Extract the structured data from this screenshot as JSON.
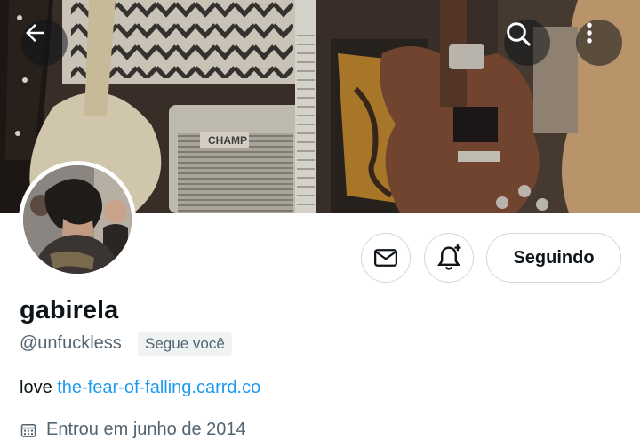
{
  "profile": {
    "display_name": "gabirela",
    "handle": "@unfuckless",
    "follows_you_badge": "Segue você",
    "bio_text": "love ",
    "bio_link": "the-fear-of-falling.carrd.co",
    "joined": "Entrou em junho de 2014"
  },
  "actions": {
    "follow_label": "Seguindo",
    "message_icon": "envelope-icon",
    "notify_icon": "bell-plus-icon"
  },
  "header": {
    "back_icon": "arrow-left-icon",
    "search_icon": "search-icon",
    "more_icon": "more-vertical-icon"
  },
  "banner": {
    "amp_label": "CHAMP"
  },
  "colors": {
    "link": "#1d9bf0",
    "secondary_text": "#536471",
    "border": "#cfd9de"
  }
}
